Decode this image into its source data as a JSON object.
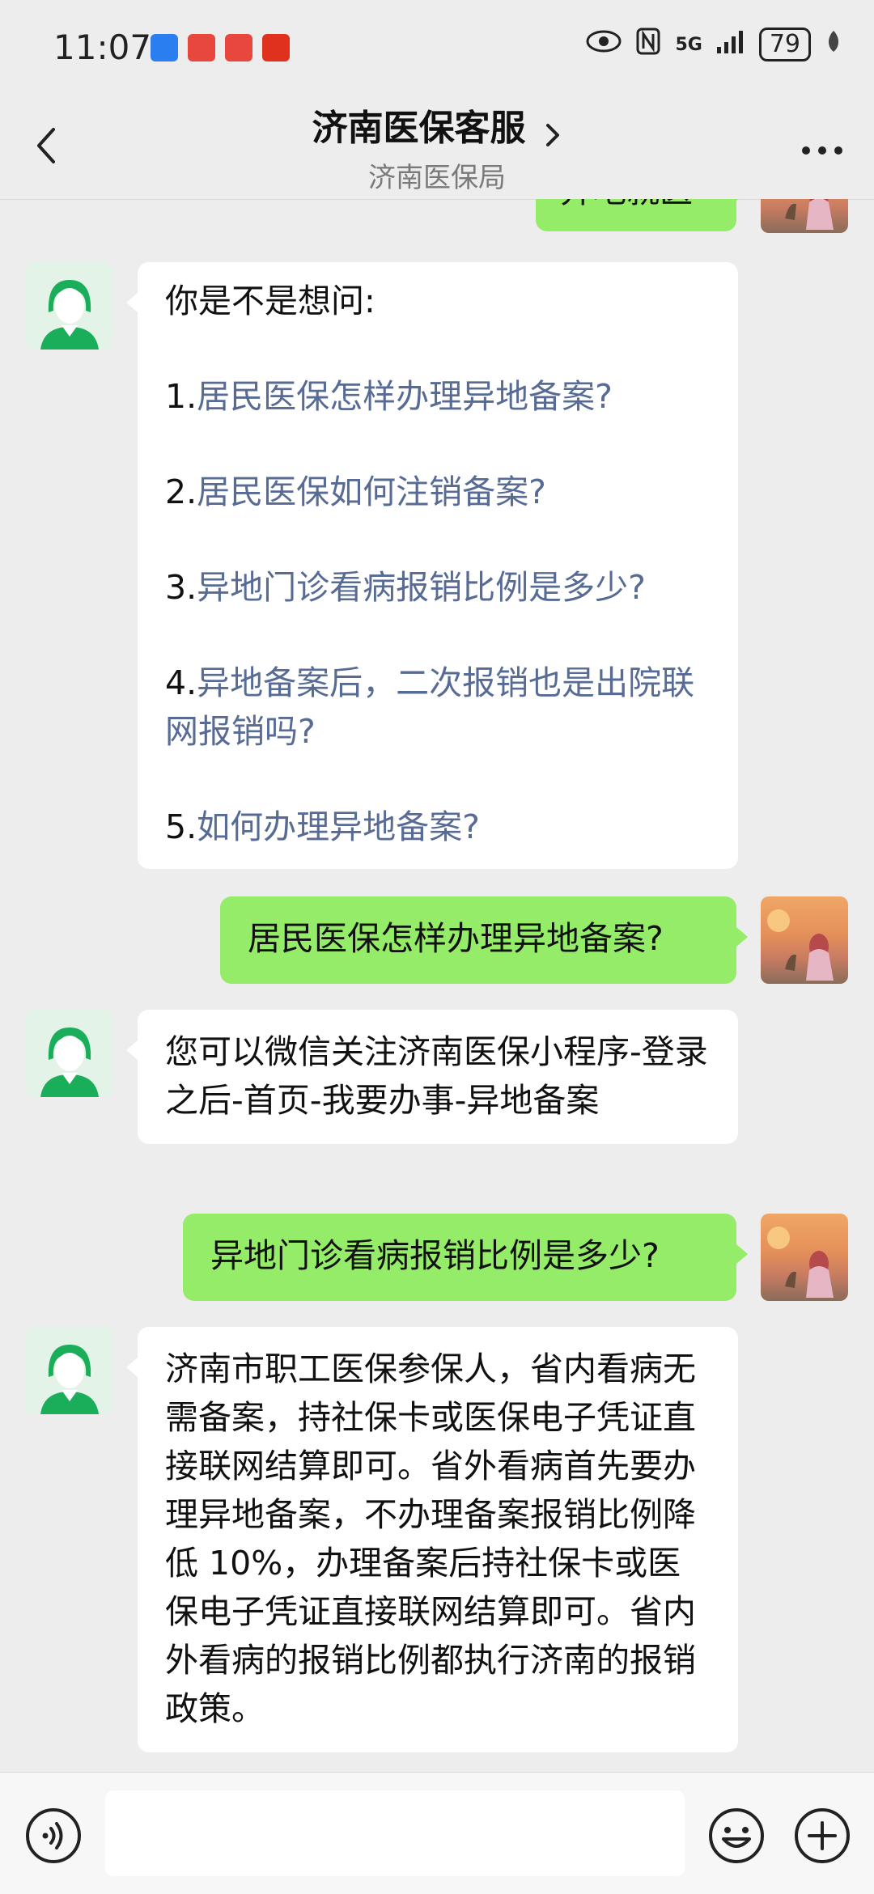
{
  "status_bar": {
    "time": "11:07",
    "network": "5G",
    "battery": "79"
  },
  "header": {
    "title": "济南医保客服",
    "subtitle": "济南医保局"
  },
  "messages": {
    "partial_top": "异地就医",
    "m1": {
      "intro": "你是不是想问:",
      "options": [
        {
          "num": "1.",
          "text": "居民医保怎样办理异地备案?"
        },
        {
          "num": "2.",
          "text": "居民医保如何注销备案?"
        },
        {
          "num": "3.",
          "text": "异地门诊看病报销比例是多少?"
        },
        {
          "num": "4.",
          "text": "异地备案后，二次报销也是出院联网报销吗?"
        },
        {
          "num": "5.",
          "text": "如何办理异地备案?"
        }
      ]
    },
    "m2": "居民医保怎样办理异地备案?",
    "m3": "您可以微信关注济南医保小程序-登录之后-首页-我要办事-异地备案",
    "m4": "异地门诊看病报销比例是多少?",
    "m5": "济南市职工医保参保人，省内看病无需备案，持社保卡或医保电子凭证直接联网结算即可。省外看病首先要办理异地备案，不办理备案报销比例降低 10%，办理备案后持社保卡或医保电子凭证直接联网结算即可。省内外看病的报销比例都执行济南的报销政策。"
  },
  "input": {
    "placeholder": ""
  },
  "colors": {
    "background": "#ededed",
    "out_bubble": "#95ec69",
    "in_bubble": "#ffffff",
    "link": "#576b95",
    "bot_avatar": "#1aad5a"
  }
}
